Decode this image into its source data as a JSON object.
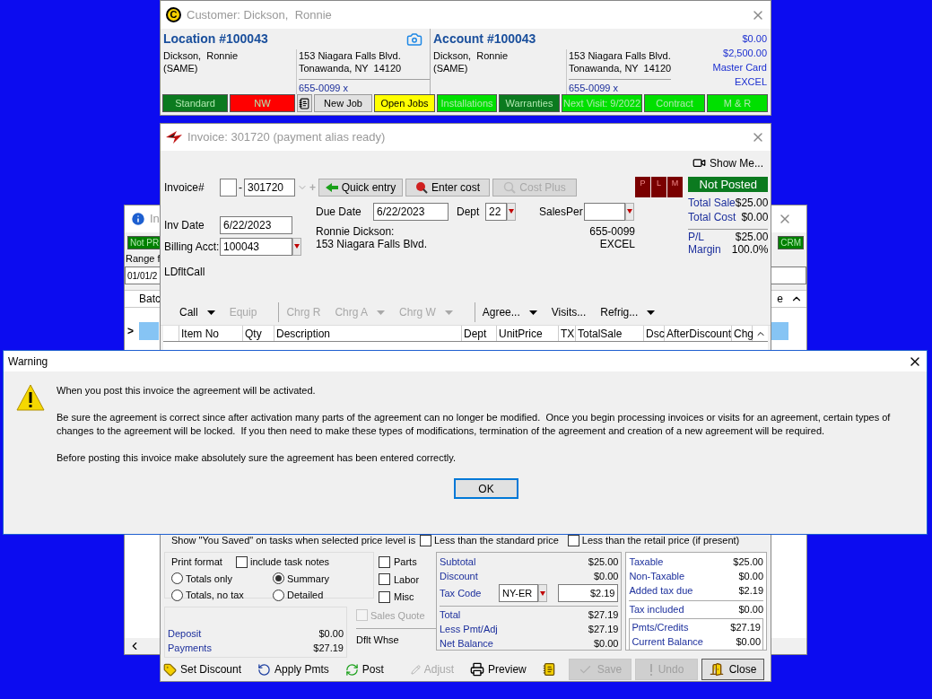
{
  "background_window": {
    "title": "In",
    "tags": [
      {
        "label": "Not PR",
        "color": "#008000"
      },
      {
        "label": "CRM",
        "color": "#008000"
      }
    ],
    "range_label": "Range f",
    "date_value": "01/01/2",
    "columns": [
      "Batc",
      "e"
    ],
    "row_marker": ">"
  },
  "customer": {
    "logo": "C",
    "title": "Customer: Dickson,  Ronnie",
    "location": {
      "heading": "Location #100043",
      "name": "Dickson,  Ronnie",
      "name2": "(SAME)",
      "address1": "153 Niagara Falls Blvd.",
      "address2": "Tonawanda, NY  14120",
      "phone": "655-0099 x"
    },
    "account": {
      "heading": "Account #100043",
      "name": "Dickson,  Ronnie",
      "name2": "(SAME)",
      "address1": "153 Niagara Falls Blvd.",
      "address2": "Tonawanda, NY  14120",
      "phone": "655-0099 x"
    },
    "balances": [
      "$0.00",
      "$2,500.00",
      "Master Card",
      "EXCEL"
    ],
    "tags": [
      {
        "kind": "tag",
        "label": "Standard",
        "color": "#0b7a1f"
      },
      {
        "kind": "tag",
        "label": "NW",
        "color": "#ff0000"
      },
      {
        "kind": "notes"
      },
      {
        "kind": "button",
        "label": "New Job"
      },
      {
        "kind": "tag",
        "label": "Open Jobs",
        "color": "#ffff00"
      },
      {
        "kind": "tag",
        "label": "Installations",
        "color": "#00e000"
      },
      {
        "kind": "tag",
        "label": "Warranties",
        "color": "#0b7a1f"
      },
      {
        "kind": "tag",
        "label": "Next Visit: 9/2022",
        "color": "#00e000"
      },
      {
        "kind": "tag",
        "label": "Contract",
        "color": "#00e000"
      },
      {
        "kind": "tag",
        "label": "M & R",
        "color": "#00e000"
      }
    ]
  },
  "invoice": {
    "title": "Invoice: 301720 (payment alias ready)",
    "show_me": "Show Me...",
    "number": {
      "label": "Invoice#",
      "separator": "-",
      "value": "301720",
      "add": "+"
    },
    "actions": [
      {
        "label": "Quick entry",
        "disabled": false
      },
      {
        "label": "Enter cost",
        "disabled": false
      },
      {
        "label": "Cost Plus",
        "disabled": true
      }
    ],
    "flags": [
      "P",
      "L",
      "M"
    ],
    "status": "Not Posted",
    "totals": [
      {
        "label": "Total Sale",
        "value": "$25.00"
      },
      {
        "label": "Total Cost",
        "value": "$0.00"
      }
    ],
    "profit": [
      {
        "label": "P/L",
        "value": "$25.00"
      },
      {
        "label": "Margin",
        "value": "100.0%"
      }
    ],
    "inv_date": {
      "label": "Inv Date",
      "value": "6/22/2023"
    },
    "billing_acct": {
      "label": "Billing Acct:",
      "value": "100043"
    },
    "default_call": "LDfltCall",
    "due_date": {
      "label": "Due Date",
      "value": "6/22/2023"
    },
    "dept": {
      "label": "Dept",
      "value": "22"
    },
    "sales_person": {
      "label": "SalesPer"
    },
    "bill_to": [
      "Ronnie Dickson:",
      "153 Niagara Falls Blvd."
    ],
    "contact": [
      "655-0099",
      "EXCEL"
    ],
    "toolbar": [
      {
        "kind": "menu",
        "label": "Call",
        "disabled": false,
        "dropdown": true
      },
      {
        "kind": "menu",
        "label": "Equip",
        "disabled": true,
        "dropdown": false
      },
      {
        "kind": "separator"
      },
      {
        "kind": "menu",
        "label": "Chrg R",
        "disabled": true,
        "dropdown": false
      },
      {
        "kind": "menu",
        "label": "Chrg A",
        "disabled": true,
        "dropdown": true
      },
      {
        "kind": "menu",
        "label": "Chrg W",
        "disabled": true,
        "dropdown": true
      },
      {
        "kind": "separator"
      },
      {
        "kind": "menu",
        "label": "Agree...",
        "disabled": false,
        "dropdown": true
      },
      {
        "kind": "menu",
        "label": "Visits...",
        "disabled": false,
        "dropdown": false
      },
      {
        "kind": "menu",
        "label": "Refrig...",
        "disabled": false,
        "dropdown": true
      }
    ],
    "columns": [
      "Item No",
      "Qty",
      "Description",
      "Dept",
      "UnitPrice",
      "TX",
      "TotalSale",
      "Dsc",
      "AfterDiscount",
      "Chg"
    ],
    "you_saved": {
      "label": "Show \"You Saved\" on tasks when selected price level is",
      "options": [
        {
          "label": "Less than the standard price",
          "checked": false
        },
        {
          "label": "Less than the retail price (if present)",
          "checked": false
        }
      ]
    },
    "print_format": {
      "label": "Print format",
      "include_notes": {
        "label": "include task notes",
        "checked": false
      },
      "options": [
        {
          "label": "Totals only",
          "selected": false
        },
        {
          "label": "Summary",
          "selected": true
        },
        {
          "label": "Totals, no tax",
          "selected": false
        },
        {
          "label": "Detailed",
          "selected": false
        }
      ]
    },
    "parts_filters": [
      {
        "label": "Parts",
        "checked": false
      },
      {
        "label": "Labor",
        "checked": false
      },
      {
        "label": "Misc",
        "checked": false
      }
    ],
    "sales_quote": {
      "label": "Sales Quote",
      "checked": false,
      "disabled": true
    },
    "warehouse": "Dflt Whse",
    "deposits": [
      {
        "label": "Deposit",
        "value": "$0.00"
      },
      {
        "label": "Payments",
        "value": "$27.19"
      }
    ],
    "subtotals": [
      {
        "label": "Subtotal",
        "value": "$25.00"
      },
      {
        "label": "Discount",
        "value": "$0.00"
      }
    ],
    "tax": {
      "label": "Tax Code",
      "code": "NY-ER",
      "amount": "$2.19"
    },
    "grand_totals": [
      {
        "label": "Total",
        "value": "$27.19"
      },
      {
        "label": "Less Pmt/Adj",
        "value": "$27.19"
      },
      {
        "label": "Net Balance",
        "value": "$0.00"
      }
    ],
    "tax_summary": [
      {
        "label": "Taxable",
        "value": "$25.00"
      },
      {
        "label": "Non-Taxable",
        "value": "$0.00"
      },
      {
        "label": "Added tax due",
        "value": "$2.19"
      }
    ],
    "tax_included": {
      "label": "Tax included",
      "value": "$0.00"
    },
    "balances": [
      {
        "label": "Pmts/Credits",
        "value": "$27.19"
      },
      {
        "label": "Current Balance",
        "value": "$0.00"
      }
    ],
    "footer": [
      {
        "kind": "tool",
        "label": "Set Discount",
        "disabled": false
      },
      {
        "kind": "tool",
        "label": "Apply Pmts",
        "disabled": false
      },
      {
        "kind": "tool",
        "label": "Post",
        "disabled": false
      },
      {
        "kind": "tool",
        "label": "Adjust",
        "disabled": true
      },
      {
        "kind": "tool",
        "label": "Preview",
        "disabled": false
      },
      {
        "kind": "notes"
      },
      {
        "kind": "push",
        "label": "Save",
        "disabled": true
      },
      {
        "kind": "push",
        "label": "Undo",
        "disabled": true
      },
      {
        "kind": "push",
        "label": "Close",
        "disabled": false
      }
    ]
  },
  "warning": {
    "title": "Warning",
    "paragraphs": [
      "When you post this invoice the agreement will be activated.",
      "Be sure the agreement is correct since after activation many parts of the agreement can no longer be modified.  Once you begin processing invoices or visits for an agreement, certain types of changes to the agreement will be locked.  If you then need to make these types of modifications, termination of the agreement and creation of a new agreement will be required.",
      "Before posting this invoice make absolutely sure the agreement has been entered correctly."
    ],
    "ok": "OK"
  }
}
